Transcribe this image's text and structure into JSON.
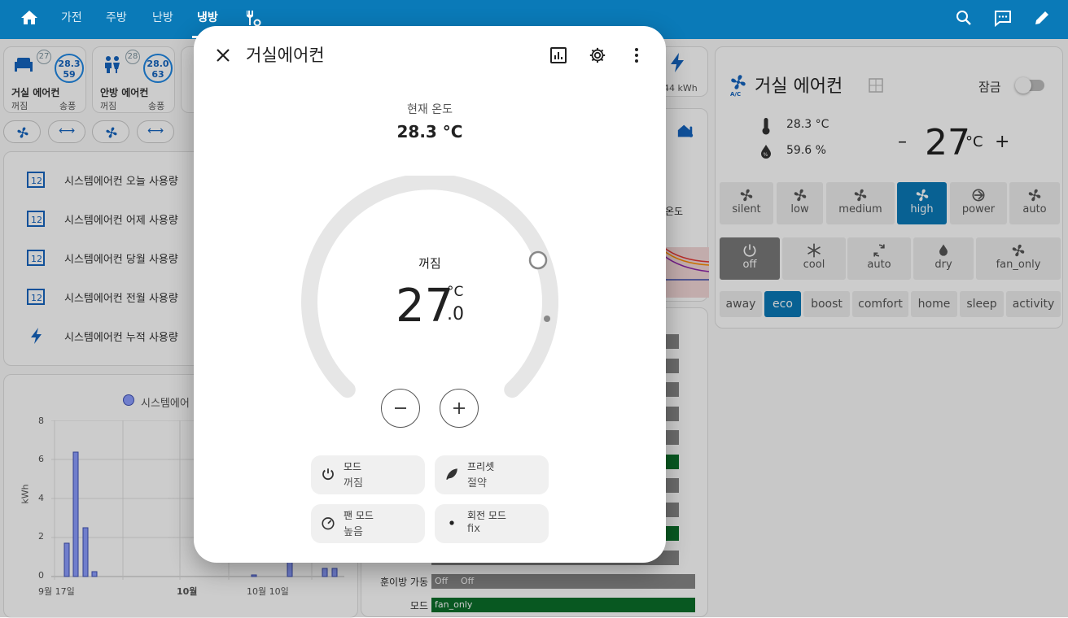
{
  "topbar": {
    "tabs": [
      "가전",
      "주방",
      "난방",
      "냉방"
    ],
    "active_tab": "냉방"
  },
  "ac_tiles": [
    {
      "name": "거실 에어컨",
      "state": "꺼짐",
      "mode": "송풍",
      "temp": "28.3",
      "humidity": "59",
      "badge": "27"
    },
    {
      "name": "안방 에어컨",
      "state": "꺼짐",
      "mode": "송풍",
      "temp": "28.0",
      "humidity": "63",
      "badge": "28"
    },
    {
      "name": "",
      "state": "",
      "mode": "",
      "temp": "",
      "humidity": "",
      "badge": ""
    }
  ],
  "energy_tile": {
    "value": "44 kWh"
  },
  "usage_list": [
    {
      "label": "시스템에어컨 오늘 사용량",
      "icon": "counter-icon"
    },
    {
      "label": "시스템에어컨 어제 사용량",
      "icon": "counter-icon"
    },
    {
      "label": "시스템에어컨 당월 사용량",
      "icon": "counter-icon"
    },
    {
      "label": "시스템에어컨 전월 사용량",
      "icon": "counter-icon"
    },
    {
      "label": "시스템에어컨 누적 사용량",
      "icon": "flash-icon"
    }
  ],
  "bg_chart": {
    "legend": "시스템에어",
    "ylabel": "kWh",
    "yticks": [
      "8",
      "6",
      "4",
      "2",
      "0"
    ],
    "xticks": [
      "9월 17일",
      "10월",
      "10월 10일"
    ]
  },
  "bg_temp_label": "온도",
  "bg_history": {
    "rows": [
      {
        "label": "훈이방 가동",
        "values": [
          "Off",
          "Off"
        ]
      },
      {
        "label": "모드",
        "values": [
          "fan_only"
        ]
      }
    ]
  },
  "right_card": {
    "title": "거실 에어컨",
    "lock_label": "잠금",
    "current_temp": "28.3 °C",
    "humidity": "59.6 %",
    "target": "27",
    "unit": "°C",
    "fan_modes": [
      "silent",
      "low",
      "medium",
      "high",
      "power",
      "auto"
    ],
    "fan_selected": "high",
    "hvac_modes": [
      "off",
      "cool",
      "auto",
      "dry",
      "fan_only"
    ],
    "hvac_selected": "off",
    "presets": [
      "away",
      "eco",
      "boost",
      "comfort",
      "home",
      "sleep",
      "activity"
    ],
    "preset_selected": "eco"
  },
  "dialog": {
    "title": "거실에어컨",
    "current_label": "현재 온도",
    "current_value": "28.3 °C",
    "state": "꺼짐",
    "target_int": "27",
    "target_dec": ".0",
    "unit": "°C",
    "features": [
      {
        "label": "모드",
        "value": "꺼짐",
        "icon": "power-icon"
      },
      {
        "label": "프리셋",
        "value": "절약",
        "icon": "leaf-icon"
      },
      {
        "label": "팬 모드",
        "value": "높음",
        "icon": "gauge-icon"
      },
      {
        "label": "회전 모드",
        "value": "fix",
        "icon": "dot-icon"
      }
    ]
  }
}
